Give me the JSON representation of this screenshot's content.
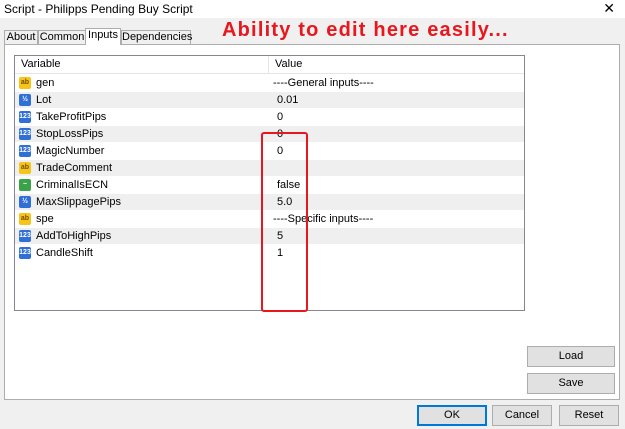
{
  "window": {
    "title": "Script - Philipps Pending Buy Script",
    "close_glyph": "✕"
  },
  "annotation": "Ability to edit here easily...",
  "tabs": [
    {
      "label": "About"
    },
    {
      "label": "Common"
    },
    {
      "label": "Inputs"
    },
    {
      "label": "Dependencies"
    }
  ],
  "grid": {
    "headers": {
      "variable": "Variable",
      "value": "Value"
    },
    "rows": [
      {
        "icon": "ab",
        "icon_name": "string-type-icon",
        "variable": "gen",
        "value": "----General inputs----"
      },
      {
        "icon": "½",
        "icon_name": "double-type-icon",
        "variable": "Lot",
        "value": "0.01"
      },
      {
        "icon": "123",
        "icon_name": "integer-type-icon",
        "variable": "TakeProfitPips",
        "value": "0"
      },
      {
        "icon": "123",
        "icon_name": "integer-type-icon",
        "variable": "StopLossPips",
        "value": "0"
      },
      {
        "icon": "123",
        "icon_name": "integer-type-icon",
        "variable": "MagicNumber",
        "value": "0"
      },
      {
        "icon": "ab",
        "icon_name": "string-type-icon",
        "variable": "TradeComment",
        "value": ""
      },
      {
        "icon": "~",
        "icon_name": "bool-type-icon",
        "variable": "CriminalIsECN",
        "value": "false"
      },
      {
        "icon": "½",
        "icon_name": "double-type-icon",
        "variable": "MaxSlippagePips",
        "value": "5.0"
      },
      {
        "icon": "ab",
        "icon_name": "string-type-icon",
        "variable": "spe",
        "value": "----Specific inputs----"
      },
      {
        "icon": "123",
        "icon_name": "integer-type-icon",
        "variable": "AddToHighPips",
        "value": "5"
      },
      {
        "icon": "123",
        "icon_name": "integer-type-icon",
        "variable": "CandleShift",
        "value": "1"
      }
    ]
  },
  "buttons": {
    "load": "Load",
    "save": "Save",
    "ok": "OK",
    "cancel": "Cancel",
    "reset": "Reset"
  },
  "colors": {
    "annotation": "#e8161d",
    "highlight_box": "#e8161d",
    "alt_row": "#efefef"
  }
}
